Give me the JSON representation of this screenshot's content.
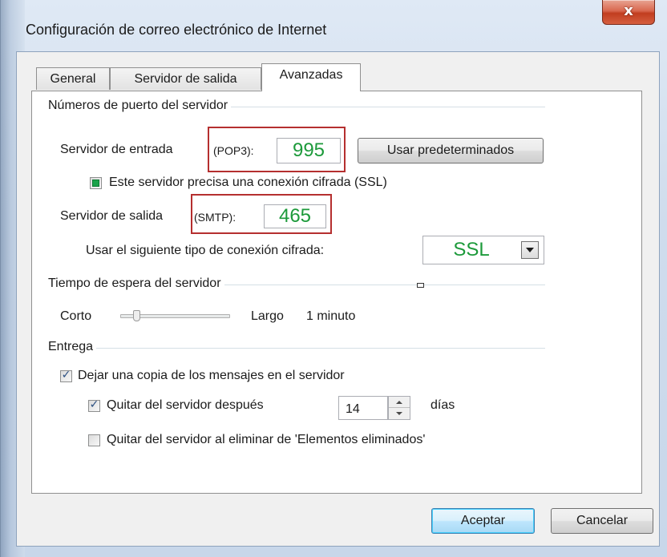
{
  "window": {
    "title": "Configuración de correo electrónico de Internet",
    "close_glyph": "x"
  },
  "tabs": [
    {
      "label": "General"
    },
    {
      "label": "Servidor de salida"
    },
    {
      "label": "Avanzadas"
    }
  ],
  "ports": {
    "group_title": "Números de puerto del servidor",
    "incoming_label": "Servidor de entrada",
    "incoming_protocol": "(POP3):",
    "incoming_value": "995",
    "defaults_button": "Usar predeterminados",
    "ssl_checkbox_label": "Este servidor precisa una conexión cifrada (SSL)",
    "outgoing_label": "Servidor de salida",
    "outgoing_protocol": "(SMTP):",
    "outgoing_value": "465",
    "encryption_label": "Usar el siguiente tipo de conexión cifrada:",
    "encryption_value": "SSL"
  },
  "timeout": {
    "group_title": "Tiempo de espera del servidor",
    "short_label": "Corto",
    "long_label": "Largo",
    "value_label": "1 minuto",
    "level": 0.12
  },
  "delivery": {
    "group_title": "Entrega",
    "leave_copy_label": "Dejar una copia de los mensajes en el servidor",
    "leave_copy_checked": true,
    "remove_after_label": "Quitar del servidor después",
    "remove_after_checked": true,
    "days_value": "14",
    "days_label": "días",
    "remove_deleted_label": "Quitar del servidor al eliminar de 'Elementos eliminados'",
    "remove_deleted_checked": false
  },
  "footer": {
    "ok_button": "Aceptar",
    "cancel_button": "Cancelar"
  },
  "colors": {
    "highlight_box": "#b52f2f",
    "value_text": "#1d9a3b",
    "close_button": "#c13d20"
  }
}
